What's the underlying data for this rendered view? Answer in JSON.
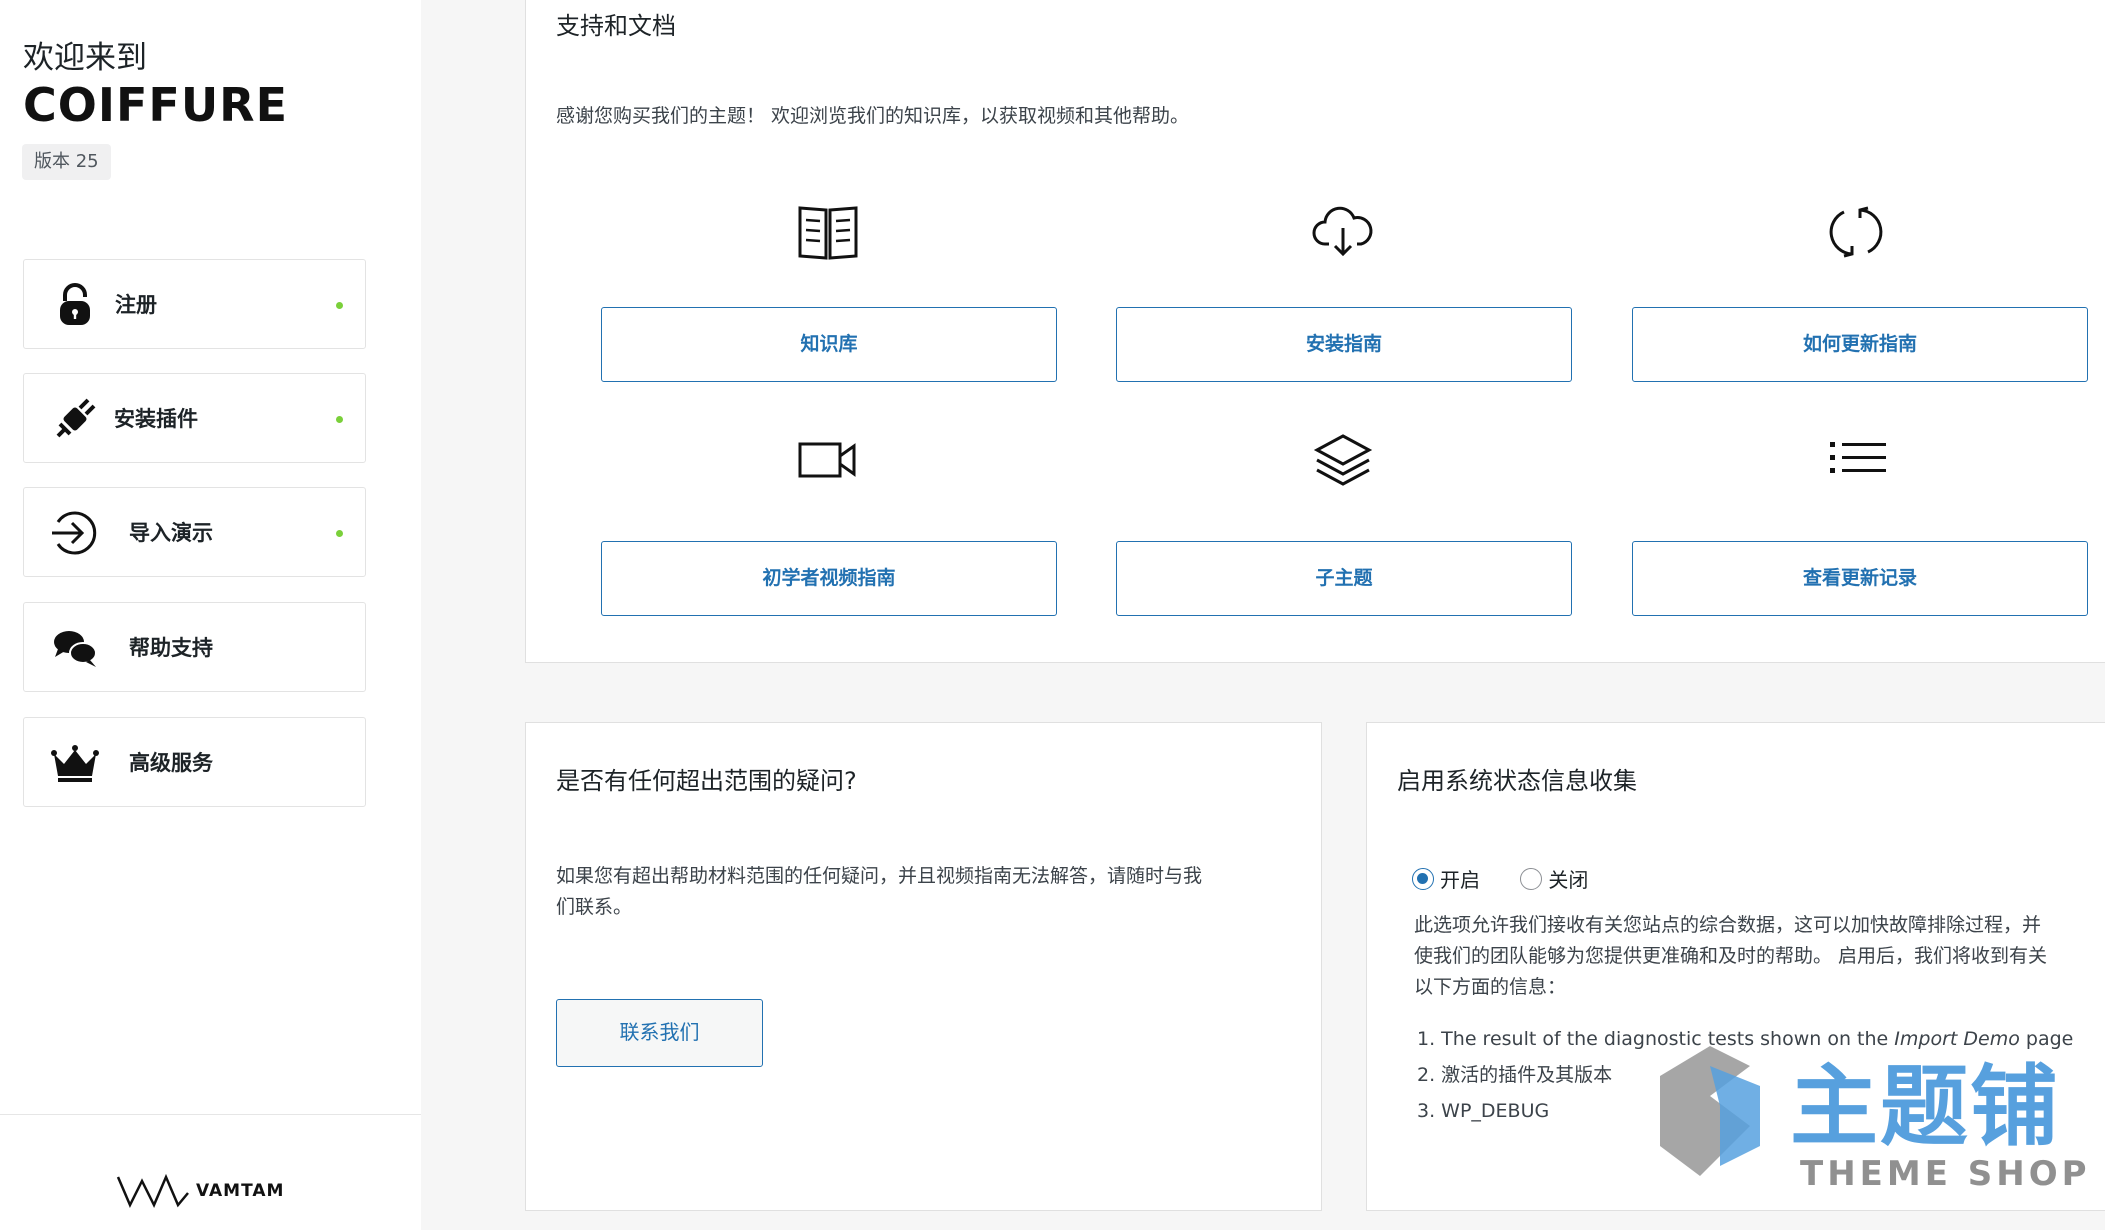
{
  "sidebar": {
    "welcome": "欢迎来到",
    "brand": "COIFFURE",
    "version": "版本 25",
    "items": [
      {
        "label": "注册",
        "icon": "lock-icon",
        "status": true
      },
      {
        "label": "安装插件",
        "icon": "plug-icon",
        "status": true
      },
      {
        "label": "导入演示",
        "icon": "import-icon",
        "status": true
      },
      {
        "label": "帮助支持",
        "icon": "chat-bubbles-icon",
        "status": false
      },
      {
        "label": "高级服务",
        "icon": "crown-icon",
        "status": false
      }
    ],
    "footer_brand": "VAMTAM",
    "status_color": "#7ad03a"
  },
  "support": {
    "title": "支持和文档",
    "intro": "感谢您购买我们的主题！ 欢迎浏览我们的知识库，以获取视频和其他帮助。",
    "cards": [
      {
        "label": "知识库",
        "icon": "book-icon"
      },
      {
        "label": "安装指南",
        "icon": "cloud-download-icon"
      },
      {
        "label": "如何更新指南",
        "icon": "refresh-icon"
      },
      {
        "label": "初学者视频指南",
        "icon": "video-camera-icon"
      },
      {
        "label": "子主题",
        "icon": "layers-icon"
      },
      {
        "label": "查看更新记录",
        "icon": "list-icon"
      }
    ]
  },
  "question": {
    "title": "是否有任何超出范围的疑问?",
    "text_line1": "如果您有超出帮助材料范围的任何疑问，并且视频指南无法解答，请随时与我",
    "text_line2": "们联系。",
    "button": "联系我们"
  },
  "status": {
    "title": "启用系统状态信息收集",
    "option_on": "开启",
    "option_off": "关闭",
    "selected": "开启",
    "desc_line1": "此选项允许我们接收有关您站点的综合数据，这可以加快故障排除过程，并",
    "desc_line2": "使我们的团队能够为您提供更准确和及时的帮助。 启用后，我们将收到有关",
    "desc_line3": "以下方面的信息：",
    "list": {
      "item1_prefix": "1. The result of the diagnostic tests shown on the ",
      "item1_em": "Import Demo",
      "item1_suffix": " page",
      "item2": "2. 激活的插件及其版本",
      "item3": "3. WP_DEBUG"
    }
  },
  "watermark": {
    "cn": "主题铺",
    "en": "THEME SHOP"
  },
  "colors": {
    "accent": "#2271b1",
    "text": "#1d2327",
    "background": "#f6f6f6"
  }
}
